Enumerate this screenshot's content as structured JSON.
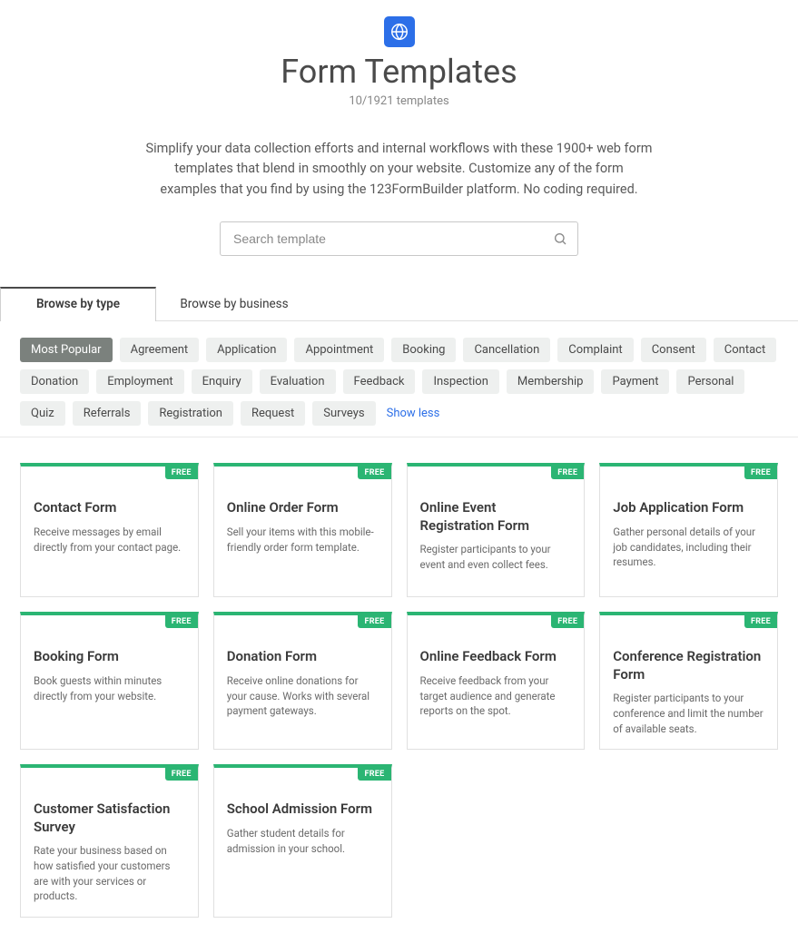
{
  "header": {
    "title": "Form Templates",
    "count_text": "10/1921 templates",
    "description": "Simplify your data collection efforts and internal workflows with these 1900+ web form templates that blend in smoothly on your website. Customize any of the form examples that you find by using the 123FormBuilder platform. No coding required."
  },
  "search": {
    "placeholder": "Search template",
    "value": ""
  },
  "tabs": [
    {
      "label": "Browse by type",
      "active": true
    },
    {
      "label": "Browse by business",
      "active": false
    }
  ],
  "chips": [
    {
      "label": "Most Popular",
      "selected": true
    },
    {
      "label": "Agreement"
    },
    {
      "label": "Application"
    },
    {
      "label": "Appointment"
    },
    {
      "label": "Booking"
    },
    {
      "label": "Cancellation"
    },
    {
      "label": "Complaint"
    },
    {
      "label": "Consent"
    },
    {
      "label": "Contact"
    },
    {
      "label": "Donation"
    },
    {
      "label": "Employment"
    },
    {
      "label": "Enquiry"
    },
    {
      "label": "Evaluation"
    },
    {
      "label": "Feedback"
    },
    {
      "label": "Inspection"
    },
    {
      "label": "Membership"
    },
    {
      "label": "Payment"
    },
    {
      "label": "Personal"
    },
    {
      "label": "Quiz"
    },
    {
      "label": "Referrals"
    },
    {
      "label": "Registration"
    },
    {
      "label": "Request"
    },
    {
      "label": "Surveys"
    }
  ],
  "show_less_label": "Show less",
  "card_badge": "FREE",
  "cards": [
    {
      "title": "Contact Form",
      "desc": "Receive messages by email directly from your contact page."
    },
    {
      "title": "Online Order Form",
      "desc": "Sell your items with this mobile-friendly order form template."
    },
    {
      "title": "Online Event Registration Form",
      "desc": "Register participants to your event and even collect fees."
    },
    {
      "title": "Job Application Form",
      "desc": "Gather personal details of your job candidates, including their resumes."
    },
    {
      "title": "Booking Form",
      "desc": "Book guests within minutes directly from your website."
    },
    {
      "title": "Donation Form",
      "desc": "Receive online donations for your cause. Works with several payment gateways."
    },
    {
      "title": "Online Feedback Form",
      "desc": "Receive feedback from your target audience and generate reports on the spot."
    },
    {
      "title": "Conference Registration Form",
      "desc": "Register participants to your conference and limit the number of available seats."
    },
    {
      "title": "Customer Satisfaction Survey",
      "desc": "Rate your business based on how satisfied your customers are with your services or products."
    },
    {
      "title": "School Admission Form",
      "desc": "Gather student details for admission in your school."
    }
  ]
}
